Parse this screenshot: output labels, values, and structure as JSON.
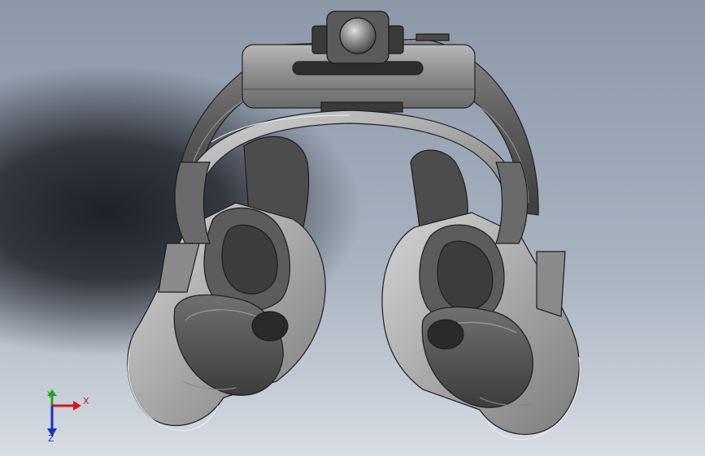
{
  "viewport": {
    "background_top": "#8c97a8",
    "background_bottom": "#d8dde4",
    "model_description_icon": "vr-headset-model"
  },
  "triad": {
    "x_label": "X",
    "y_label": "Y",
    "z_label": "Z",
    "x_color": "#d01818",
    "y_color": "#18a818",
    "z_color": "#1830c8"
  }
}
